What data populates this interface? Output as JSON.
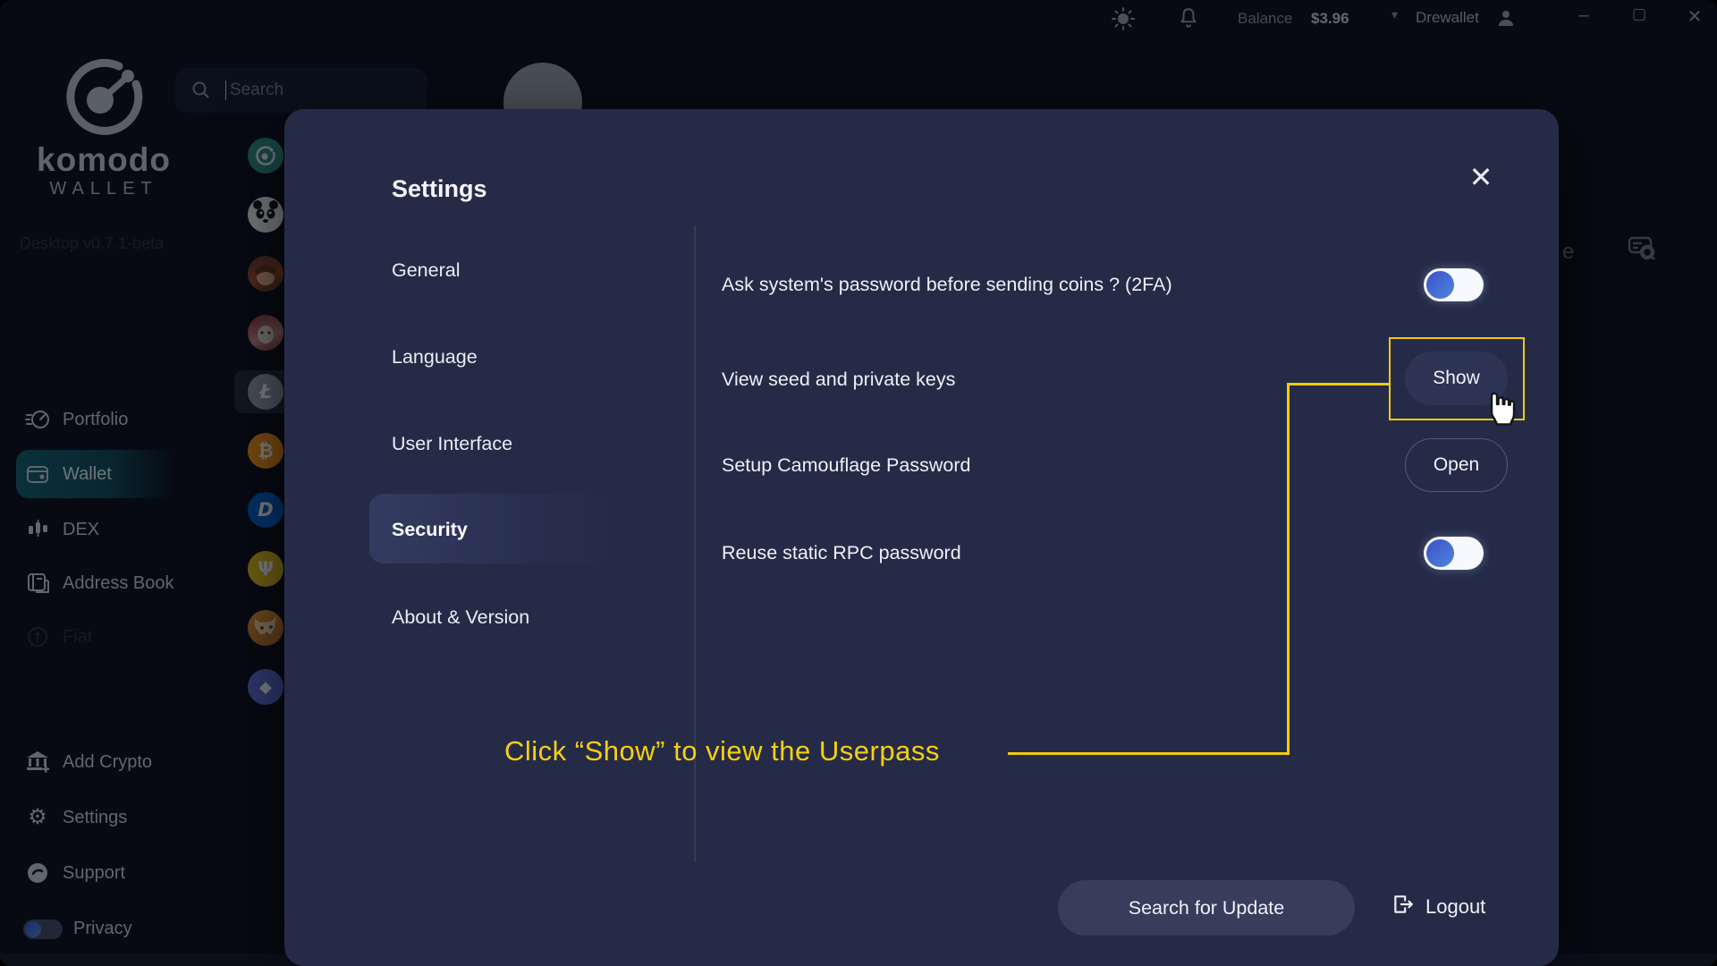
{
  "title_bar": {
    "balance_label": "Balance",
    "balance_value": "$3.96",
    "caret": "▾",
    "account_name": "Drewallet",
    "minimize": "–",
    "maximize": "▢",
    "close": "✕"
  },
  "sidebar": {
    "logo_title": "komodo",
    "logo_subtitle": "WALLET",
    "version": "Desktop v0.7.1-beta",
    "items": [
      {
        "label": "Portfolio"
      },
      {
        "label": "Wallet"
      },
      {
        "label": "DEX"
      },
      {
        "label": "Address Book"
      },
      {
        "label": "Fiat"
      }
    ],
    "footer_items": [
      {
        "label": "Add Crypto"
      },
      {
        "label": "Settings"
      },
      {
        "label": "Support"
      }
    ],
    "privacy_label": "Privacy"
  },
  "coin_column": {
    "search_placeholder": "Search",
    "coins": [
      {
        "name": "komodo-coin",
        "glyph": ""
      },
      {
        "name": "panda-coin",
        "glyph": ""
      },
      {
        "name": "character-coin-1",
        "glyph": ""
      },
      {
        "name": "character-coin-2",
        "glyph": ""
      },
      {
        "name": "litecoin",
        "glyph": "Ł"
      },
      {
        "name": "bitcoin",
        "glyph": "₿"
      },
      {
        "name": "digibyte",
        "glyph": "D"
      },
      {
        "name": "psi-token",
        "glyph": "Ψ"
      },
      {
        "name": "shiba-coin",
        "glyph": ""
      },
      {
        "name": "ethereum",
        "glyph": "◆"
      }
    ]
  },
  "background_page": {
    "partial_text": "e"
  },
  "modal": {
    "title": "Settings",
    "close_glyph": "✕",
    "tabs": [
      "General",
      "Language",
      "User Interface",
      "Security",
      "About & Version"
    ],
    "active_tab": "Security",
    "rows": [
      {
        "label": "Ask system's password before sending coins ? (2FA)",
        "control": "toggle",
        "state": "on"
      },
      {
        "label": "View seed and private keys",
        "control": "button",
        "button_label": "Show"
      },
      {
        "label": "Setup Camouflage Password",
        "control": "button",
        "button_label": "Open"
      },
      {
        "label": "Reuse static RPC password",
        "control": "toggle",
        "state": "on"
      }
    ],
    "footer": {
      "update_button": "Search for Update",
      "logout_label": "Logout"
    }
  },
  "annotation": {
    "text": "Click “Show” to view the Userpass",
    "color": "#f2ca0d"
  }
}
